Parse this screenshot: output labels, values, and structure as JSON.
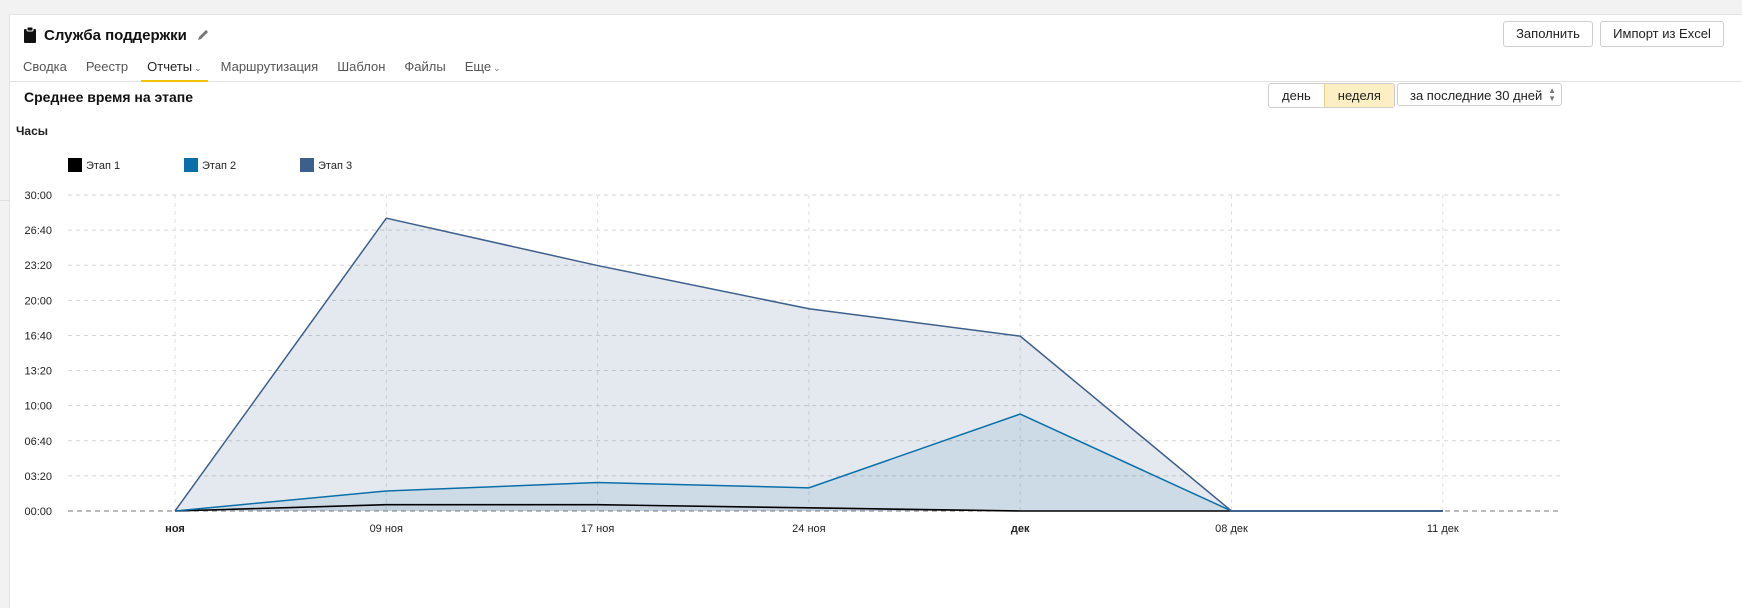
{
  "header": {
    "title": "Служба поддержки",
    "tabs": [
      {
        "label": "Сводка",
        "active": false,
        "dropdown": false
      },
      {
        "label": "Реестр",
        "active": false,
        "dropdown": false
      },
      {
        "label": "Отчеты",
        "active": true,
        "dropdown": true
      },
      {
        "label": "Маршрутизация",
        "active": false,
        "dropdown": false
      },
      {
        "label": "Шаблон",
        "active": false,
        "dropdown": false
      },
      {
        "label": "Файлы",
        "active": false,
        "dropdown": false
      },
      {
        "label": "Еще",
        "active": false,
        "dropdown": true
      }
    ],
    "buttons": {
      "fill": "Заполнить",
      "import": "Импорт из Excel"
    }
  },
  "report": {
    "title": "Среднее время на этапе",
    "granularity": {
      "day": "день",
      "week": "неделя",
      "selected": "неделя"
    },
    "period": "за последние 30 дней"
  },
  "colors": {
    "stage1": "#000000",
    "stage2": "#0a6fa8",
    "stage3": "#3d5f8c",
    "accent": "#f3c200"
  },
  "icons": {
    "title": "clipboard-icon",
    "edit": "pencil-icon",
    "dropdown": "chevron-down-icon",
    "period": "up-down-arrows-icon"
  },
  "chart_data": {
    "type": "area",
    "ylabel": "Часы",
    "y_ticks": [
      "00:00",
      "03:20",
      "06:40",
      "10:00",
      "13:20",
      "16:40",
      "20:00",
      "23:20",
      "26:40",
      "30:00"
    ],
    "ylim_hours": [
      0,
      30
    ],
    "x": [
      "ноя",
      "09 ноя",
      "17 ноя",
      "24 ноя",
      "дек",
      "08 дек",
      "11 дек"
    ],
    "x_bold": [
      "ноя",
      "дек"
    ],
    "grid": true,
    "legend_position": "top-left",
    "series": [
      {
        "name": "Этап 1",
        "color": "#000000",
        "values": [
          0,
          0.6,
          0.6,
          0.3,
          0,
          0,
          0
        ]
      },
      {
        "name": "Этап 2",
        "color": "#0a6fa8",
        "values": [
          0,
          1.9,
          2.7,
          2.2,
          9.2,
          0,
          0
        ]
      },
      {
        "name": "Этап 3",
        "color": "#3d5f8c",
        "values": [
          0,
          27.8,
          23.3,
          19.2,
          16.6,
          0,
          0
        ]
      }
    ]
  }
}
